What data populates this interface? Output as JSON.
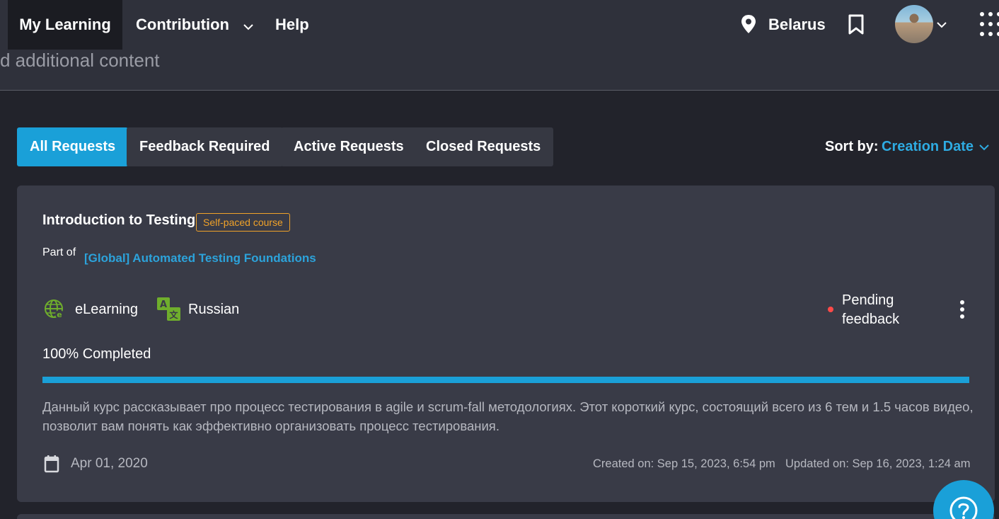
{
  "nav": {
    "my_learning": "My Learning",
    "contribution": "Contribution",
    "help": "Help",
    "location": "Belarus",
    "icons": [
      "location-pin-icon",
      "bookmark-icon",
      "avatar",
      "chevron-down-icon",
      "apps-grid-icon"
    ]
  },
  "subheader": {
    "text": "d additional content"
  },
  "tabs": [
    {
      "label": "All Requests",
      "active": true
    },
    {
      "label": "Feedback Required",
      "active": false
    },
    {
      "label": "Active Requests",
      "active": false
    },
    {
      "label": "Closed Requests",
      "active": false
    }
  ],
  "sort": {
    "label": "Sort by:",
    "value": "Creation Date"
  },
  "card": {
    "title": "Introduction to Testing",
    "badge": "Self-paced course",
    "part_of_label": "Part of",
    "part_of_link": "[Global] Automated Testing Foundations",
    "format": "eLearning",
    "language": "Russian",
    "status": "Pending feedback",
    "progress_label": "100% Completed",
    "progress_fraction": 1.0,
    "description": "Данный курс рассказывает про процесс тестирования в agile и scrum-fall методологиях. Этот короткий курс, состоящий всего из 6 тем и 1.5 часов видео, позволит вам понять как эффективно организовать процесс тестирования.",
    "date": "Apr 01, 2020",
    "created_on": "Created on: Sep 15, 2023, 6:54 pm",
    "updated_on": "Updated on: Sep 16, 2023, 1:24 am"
  },
  "colors": {
    "accent": "#1aa0d8",
    "badge": "#f0a229",
    "status_dot": "#ff4a48",
    "background": "#22232b",
    "card": "#393b47"
  }
}
